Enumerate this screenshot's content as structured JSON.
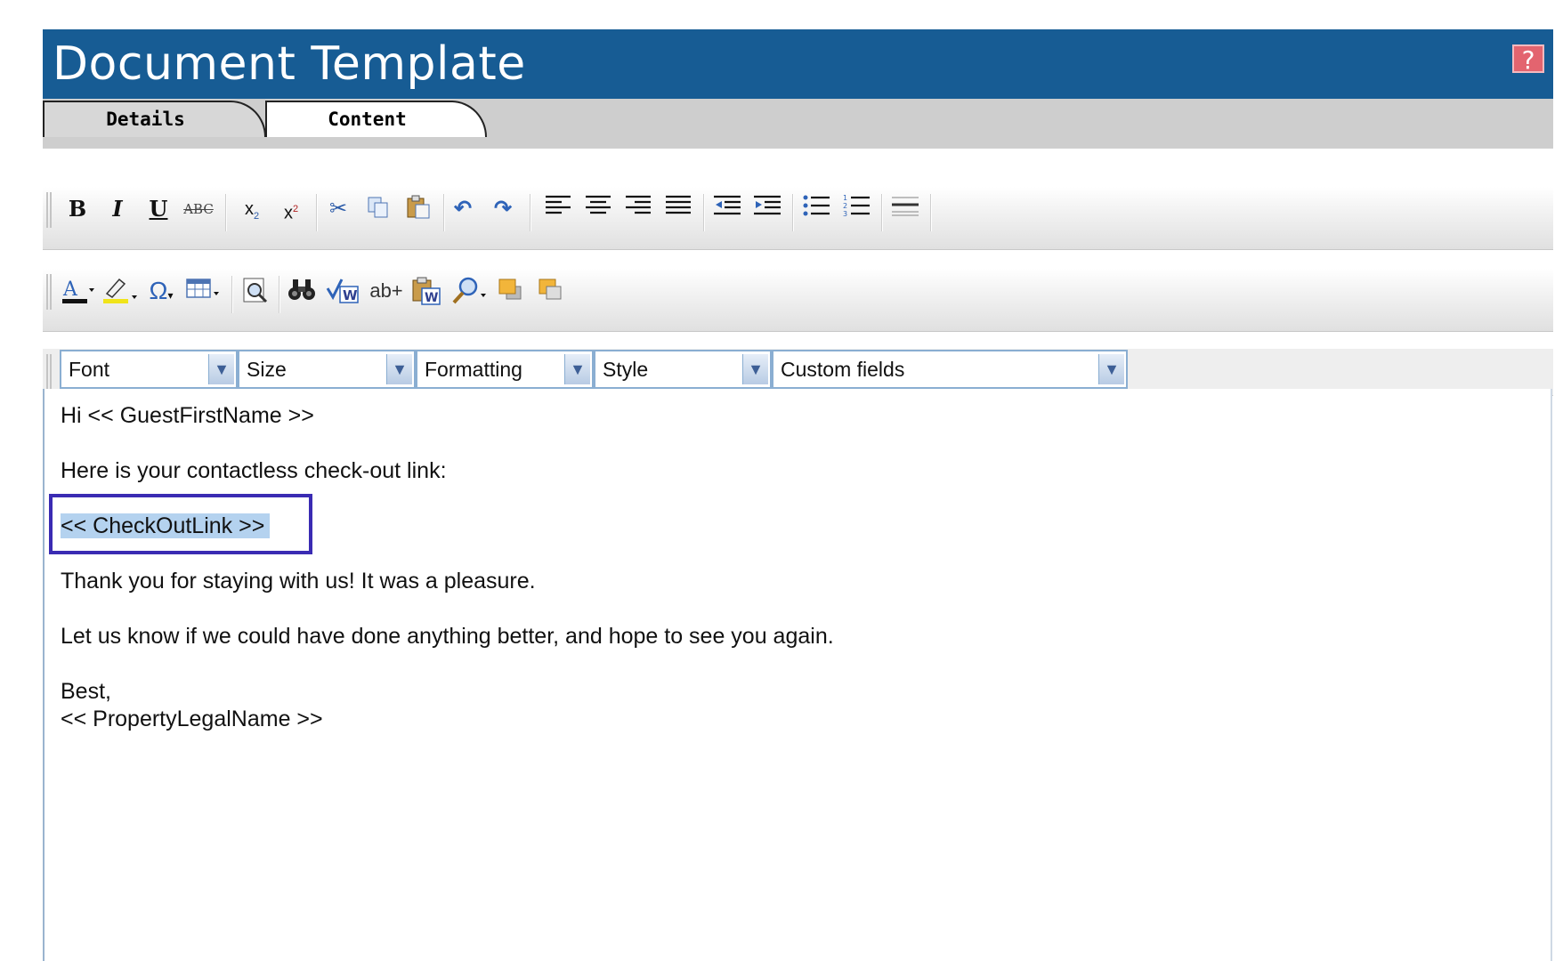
{
  "header": {
    "title": "Document Template",
    "help_label": "?"
  },
  "tabs": [
    {
      "label": "Details"
    },
    {
      "label": "Content"
    }
  ],
  "toolbar": {
    "row1_icons": [
      "bold-icon",
      "italic-icon",
      "underline-icon",
      "strikethrough-icon",
      "subscript-icon",
      "superscript-icon",
      "cut-icon",
      "copy-icon",
      "paste-icon",
      "undo-icon",
      "redo-icon",
      "align-left-icon",
      "align-center-icon",
      "align-right-icon",
      "justify-icon",
      "outdent-icon",
      "indent-icon",
      "bulleted-list-icon",
      "numbered-list-icon",
      "horizontal-rule-icon"
    ],
    "row2_icons": [
      "font-color-icon",
      "highlight-color-icon",
      "special-character-icon",
      "table-icon",
      "preview-icon",
      "find-icon",
      "spellcheck-icon",
      "replace-icon",
      "paste-from-word-icon",
      "zoom-icon",
      "bring-forward-icon",
      "send-backward-icon"
    ],
    "text_glyphs": {
      "strike": "ABC",
      "replace": "ab+"
    }
  },
  "dropdowns": {
    "font": "Font",
    "size": "Size",
    "formatting": "Formatting",
    "style": "Style",
    "custom_fields": "Custom fields"
  },
  "document": {
    "line1": "Hi << GuestFirstName >>",
    "line2": "Here is your contactless check-out link:",
    "line3": "<< CheckOutLink >>",
    "line4": "Thank you for staying with us! It was a pleasure.",
    "line5": "Let us know if we could have done anything better, and hope to see you again.",
    "line6": "Best,",
    "line7": "<< PropertyLegalName >>"
  },
  "colors": {
    "header_bg": "#175c94",
    "selection": "#b4d2ef",
    "highlight_border": "#3a2bb3"
  }
}
